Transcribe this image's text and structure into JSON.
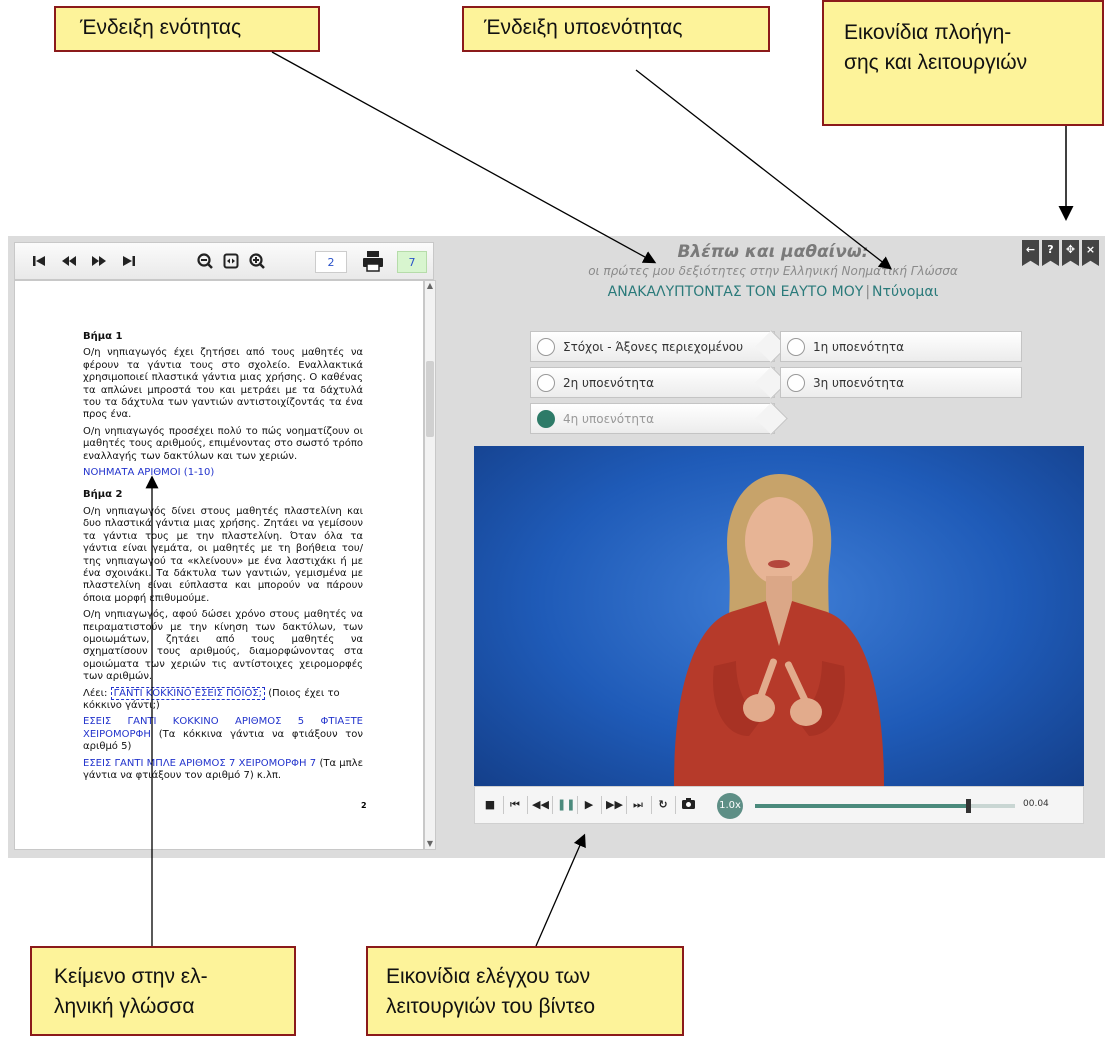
{
  "callouts": {
    "section": "Ένδειξη ενότητας",
    "subsection": "Ένδειξη υποενότητας",
    "nav_line1": "Εικονίδια πλοήγη-",
    "nav_line2": "σης και λειτουργιών",
    "text_line1": "Κείμενο στην ελ-",
    "text_line2": "ληνική γλώσσα",
    "video_line1": "Εικονίδια ελέγχου των",
    "video_line2": "λειτουργιών του βίντεο"
  },
  "reader": {
    "page_field": "2",
    "total_pages": "7",
    "page_number": "2",
    "step1_title": "Βήμα 1",
    "step1_p1": "Ο/η νηπιαγωγός έχει ζητήσει από τους μαθητές να φέρουν τα γάντια τους στο σχολείο. Εναλλακτικά χρησιμοποιεί πλαστικά γάντια μιας χρήσης. Ο καθένας τα απλώνει μπροστά του και μετράει με τα δάχτυλά του τα δάχτυλα των γαντιών αντιστοιχίζοντάς τα ένα προς ένα.",
    "step1_p2": "Ο/η νηπιαγωγός προσέχει πολύ το πώς νοηματίζουν οι μαθητές τους αριθμούς, επιμένοντας στο σωστό τρόπο εναλλαγής των δακτύλων και των χεριών.",
    "step1_link": "ΝΟΗΜΑΤΑ ΑΡΙΘΜΟΙ (1-10)",
    "step2_title": "Βήμα 2",
    "step2_p1": "Ο/η νηπιαγωγός δίνει στους μαθητές πλαστελίνη και δυο πλαστικά γάντια μιας χρήσης. Ζητάει να γεμίσουν τα γάντια τους με την πλαστελίνη. Όταν όλα τα γάντια είναι γεμάτα, οι μαθητές με τη βοήθεια του/της νηπιαγωγού τα «κλείνουν» με ένα λαστιχάκι ή με ένα σχοινάκι. Τα δάκτυλα των γαντιών, γεμισμένα με πλαστελίνη είναι εύπλαστα και μπορούν να πάρουν όποια μορφή επιθυμούμε.",
    "step2_p2": "Ο/η νηπιαγωγός, αφού δώσει χρόνο στους μαθητές να πειραματιστούν με την κίνηση των δακτύλων, των ομοιωμάτων, ζητάει από τους μαθητές να σχηματίσουν τους αριθμούς, διαμορφώνοντας στα ομοιώματα των χεριών τις αντίστοιχες χειρομορφές των αριθμών.",
    "says_label": "Λέει:",
    "says_sign": "ΓΑΝΤΙ ΚΟΚΚΙΝΟ ΕΣΕΙΣ ΠΟΙΟΣ;",
    "says_trans": "(Ποιος έχει το κόκκινο γάντι;)",
    "ex1_sign": "ΕΣΕΙΣ ΓΑΝΤΙ ΚΟΚΚΙΝΟ ΑΡΙΘΜΟΣ 5 ΦΤΙΑΞΤΕ ΧΕΙΡΟΜΟΡΦΗ",
    "ex1_trans": "(Τα κόκκινα γάντια να φτιάξουν τον αριθμό 5)",
    "ex2_sign": "ΕΣΕΙΣ ΓΑΝΤΙ ΜΠΛΕ ΑΡΙΘΜΟΣ 7 ΧΕΙΡΟΜΟΡΦΗ 7",
    "ex2_trans": "(Τα μπλε γάντια να φτιάξουν τον αριθμό 7) κ.λπ."
  },
  "header": {
    "title": "Βλέπω και μαθαίνω:",
    "subtitle": "οι πρώτες μου δεξιότητες στην Ελληνική Νοηματική Γλώσσα",
    "section": "ΑΝΑΚΑΛΥΠΤΟΝΤΑΣ ΤΟΝ ΕΑΥΤΟ ΜΟΥ",
    "separator": "|",
    "subsection": "Ντύνομαι"
  },
  "tabs": [
    {
      "label": "Στόχοι - Άξονες περιεχομένου",
      "selected": false
    },
    {
      "label": "1η υποενότητα",
      "selected": false
    },
    {
      "label": "2η υποενότητα",
      "selected": false
    },
    {
      "label": "3η υποενότητα",
      "selected": false
    },
    {
      "label": "4η υποενότητα",
      "selected": true
    }
  ],
  "video": {
    "speed": "1.0x",
    "time": "00.04",
    "progress": 0.82
  },
  "colors": {
    "accent": "#2e7b68",
    "callout_bg": "#fdf39a",
    "callout_border": "#8b1a1a",
    "video_bg": "#1f5bb8"
  }
}
